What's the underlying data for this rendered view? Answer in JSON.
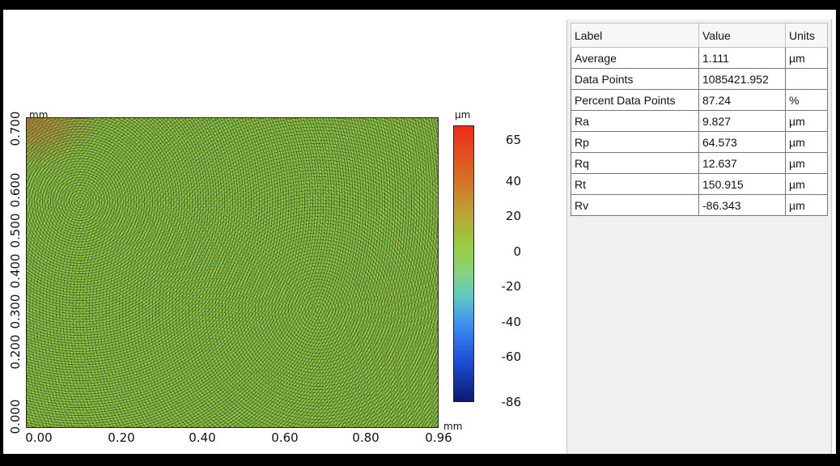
{
  "plot": {
    "y_unit": "mm",
    "x_unit": "mm",
    "colorbar_unit": "µm",
    "y_ticks": [
      "0.000",
      "0.200",
      "0.300",
      "0.400",
      "0.500",
      "0.600",
      "0.700"
    ],
    "x_ticks": [
      "0.00",
      "0.20",
      "0.40",
      "0.60",
      "0.80",
      "0.96"
    ],
    "colorbar_ticks": [
      "65",
      "40",
      "20",
      "0",
      "-20",
      "-40",
      "-60",
      "-86"
    ],
    "colorbar_range": [
      -86,
      65
    ],
    "colors": {
      "high": "#ee2b1b",
      "mid": "#98ce43",
      "low": "#0a1a70",
      "surface_base": "#94cc42"
    }
  },
  "table": {
    "headers": {
      "label": "Label",
      "value": "Value",
      "units": "Units"
    },
    "rows": [
      {
        "label": "Average",
        "value": "1.111",
        "units": "µm"
      },
      {
        "label": "Data Points",
        "value": "1085421.952",
        "units": ""
      },
      {
        "label": "Percent Data Points",
        "value": "87.24",
        "units": "%"
      },
      {
        "label": "Ra",
        "value": "9.827",
        "units": "µm"
      },
      {
        "label": "Rp",
        "value": "64.573",
        "units": "µm"
      },
      {
        "label": "Rq",
        "value": "12.637",
        "units": "µm"
      },
      {
        "label": "Rt",
        "value": "150.915",
        "units": "µm"
      },
      {
        "label": "Rv",
        "value": "-86.343",
        "units": "µm"
      }
    ]
  }
}
